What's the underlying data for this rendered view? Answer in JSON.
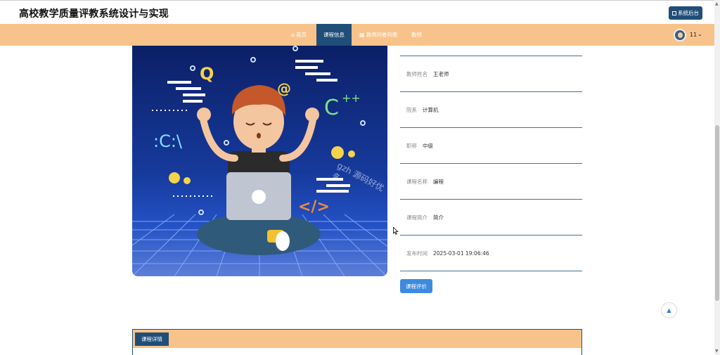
{
  "header": {
    "site_title": "高校教学质量评教系统设计与实现",
    "admin_button": "系统后台"
  },
  "nav": {
    "items": [
      {
        "label": "首页",
        "icon": "home-icon",
        "active": false
      },
      {
        "label": "课程信息",
        "icon": "",
        "active": true
      },
      {
        "label": "教师问卷列表",
        "icon": "calendar-icon",
        "active": false
      },
      {
        "label": "教师",
        "icon": "",
        "active": false
      }
    ]
  },
  "user": {
    "name": "11"
  },
  "hero": {
    "watermark": "gzh 源码好优多"
  },
  "info": {
    "rows": [
      {
        "label": "教师姓名",
        "value": "王老师"
      },
      {
        "label": "院系",
        "value": "计算机"
      },
      {
        "label": "职称",
        "value": "中级"
      },
      {
        "label": "课程名称",
        "value": "编程"
      },
      {
        "label": "课程简介",
        "value": "简介"
      },
      {
        "label": "发布时间",
        "value": "2025-03-01 19:06:46"
      }
    ]
  },
  "actions": {
    "evaluate_button": "课程评价"
  },
  "detail": {
    "tab_label": "课程详情"
  },
  "colors": {
    "navbar": "#f8c38a",
    "primary_dark": "#1f4e79",
    "button_blue": "#3d8be0"
  }
}
